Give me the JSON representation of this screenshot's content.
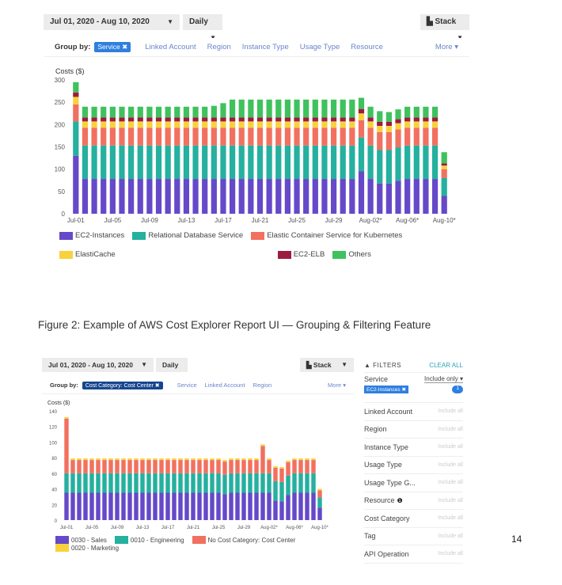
{
  "figure1": {
    "date_range": "Jul 01, 2020 - Aug 10, 2020",
    "granularity": "Daily",
    "chart_style": "Stack",
    "group_by_label": "Group by:",
    "group_by_chip": "Service",
    "group_links": [
      "Linked Account",
      "Region",
      "Instance Type",
      "Usage Type",
      "Resource"
    ],
    "more": "More"
  },
  "caption": "Figure 2: Example of AWS Cost Explorer Report UI — Grouping & Filtering Feature",
  "figure2": {
    "date_range": "Jul 01, 2020 - Aug 10, 2020",
    "granularity": "Daily",
    "chart_style": "Stack",
    "group_by_label": "Group by:",
    "group_by_chip": "Cost Category: Cost Center",
    "group_links": [
      "Service",
      "Linked Account",
      "Region"
    ],
    "more": "More",
    "filters": {
      "title": "FILTERS",
      "clear_all": "CLEAR ALL",
      "service": {
        "label": "Service",
        "mode": "Include only",
        "chip": "EC2-Instances",
        "count": "1"
      },
      "rows": [
        {
          "label": "Linked Account",
          "value": "Include all"
        },
        {
          "label": "Region",
          "value": "Include all"
        },
        {
          "label": "Instance Type",
          "value": "Include all"
        },
        {
          "label": "Usage Type",
          "value": "Include all"
        },
        {
          "label": "Usage Type G...",
          "value": "Include all"
        },
        {
          "label": "Resource",
          "value": "Include all"
        },
        {
          "label": "Cost Category",
          "value": "Include all"
        },
        {
          "label": "Tag",
          "value": "Include all"
        },
        {
          "label": "API Operation",
          "value": "Include all"
        }
      ]
    }
  },
  "page_number": "14",
  "chart_data": [
    {
      "type": "bar",
      "stacked": true,
      "ylabel": "Costs ($)",
      "ylim": [
        0,
        300
      ],
      "yticks": [
        0,
        50,
        100,
        150,
        200,
        250,
        300
      ],
      "xtick_labels": [
        "Jul-01",
        "Jul-05",
        "Jul-09",
        "Jul-13",
        "Jul-17",
        "Jul-21",
        "Jul-25",
        "Jul-29",
        "Aug-02*",
        "Aug-06*",
        "Aug-10*"
      ],
      "x": "daily Jul-01 .. Aug-10 (41 days)",
      "legend_position": "bottom",
      "series": [
        {
          "name": "EC2-Instances",
          "color": "#6549c9",
          "values": [
            130,
            78,
            78,
            78,
            78,
            78,
            78,
            78,
            78,
            78,
            78,
            78,
            78,
            78,
            78,
            78,
            78,
            78,
            78,
            78,
            78,
            78,
            78,
            78,
            78,
            78,
            78,
            78,
            78,
            78,
            78,
            95,
            78,
            68,
            68,
            74,
            78,
            78,
            78,
            78,
            40
          ]
        },
        {
          "name": "Relational Database Service",
          "color": "#25b09f",
          "values": [
            77,
            75,
            75,
            75,
            75,
            75,
            75,
            75,
            75,
            75,
            75,
            75,
            75,
            75,
            75,
            75,
            75,
            75,
            75,
            75,
            75,
            75,
            75,
            75,
            75,
            75,
            75,
            75,
            75,
            75,
            75,
            76,
            75,
            75,
            75,
            75,
            75,
            75,
            75,
            75,
            40
          ]
        },
        {
          "name": "Elastic Container Service for Kubernetes",
          "color": "#f2705f",
          "values": [
            38,
            40,
            40,
            40,
            40,
            40,
            40,
            40,
            40,
            40,
            40,
            40,
            40,
            40,
            40,
            40,
            40,
            40,
            40,
            40,
            40,
            40,
            40,
            40,
            40,
            40,
            40,
            40,
            40,
            40,
            40,
            39,
            40,
            40,
            40,
            40,
            40,
            40,
            40,
            40,
            20
          ]
        },
        {
          "name": "ElastiCache",
          "color": "#f8d23c",
          "values": [
            17,
            14,
            14,
            14,
            14,
            14,
            14,
            14,
            14,
            14,
            14,
            14,
            14,
            14,
            14,
            14,
            14,
            14,
            14,
            14,
            14,
            14,
            14,
            14,
            14,
            14,
            14,
            14,
            14,
            14,
            14,
            15,
            14,
            14,
            14,
            14,
            14,
            14,
            14,
            14,
            8
          ]
        },
        {
          "name": "EC2-ELB",
          "color": "#9c1c3f",
          "values": [
            10,
            9,
            9,
            9,
            9,
            9,
            9,
            9,
            9,
            9,
            9,
            9,
            9,
            9,
            9,
            9,
            9,
            9,
            9,
            9,
            9,
            9,
            9,
            9,
            9,
            9,
            9,
            9,
            9,
            9,
            9,
            10,
            9,
            9,
            9,
            9,
            9,
            9,
            9,
            9,
            5
          ]
        },
        {
          "name": "Others",
          "color": "#3fc25d",
          "values": [
            23,
            24,
            24,
            24,
            24,
            24,
            24,
            24,
            24,
            24,
            24,
            24,
            24,
            24,
            24,
            26,
            32,
            40,
            40,
            40,
            40,
            40,
            40,
            40,
            40,
            40,
            40,
            40,
            40,
            40,
            40,
            25,
            24,
            24,
            22,
            22,
            24,
            24,
            24,
            24,
            25
          ]
        }
      ]
    },
    {
      "type": "bar",
      "stacked": true,
      "ylabel": "Costs ($)",
      "ylim": [
        0,
        140
      ],
      "yticks": [
        0,
        20,
        40,
        60,
        80,
        100,
        120,
        140
      ],
      "xtick_labels": [
        "Jul-01",
        "Jul-05",
        "Jul-09",
        "Jul-13",
        "Jul-17",
        "Jul-21",
        "Jul-25",
        "Jul-29",
        "Aug-02*",
        "Aug-06*",
        "Aug-10*"
      ],
      "x": "daily Jul-01 .. Aug-10 (41 days)",
      "legend_position": "bottom",
      "series": [
        {
          "name": "0030 - Sales",
          "color": "#6549c9",
          "values": [
            35,
            35,
            35,
            35,
            35,
            35,
            35,
            35,
            35,
            35,
            35,
            35,
            35,
            35,
            35,
            35,
            35,
            35,
            35,
            35,
            35,
            35,
            35,
            35,
            35,
            33,
            35,
            35,
            35,
            35,
            35,
            35,
            35,
            25,
            24,
            32,
            35,
            35,
            35,
            35,
            16
          ]
        },
        {
          "name": "0010 - Engineering",
          "color": "#25b09f",
          "values": [
            25,
            25,
            25,
            25,
            25,
            25,
            25,
            25,
            25,
            25,
            25,
            25,
            25,
            25,
            25,
            25,
            25,
            25,
            25,
            25,
            25,
            25,
            25,
            25,
            25,
            25,
            25,
            25,
            25,
            25,
            25,
            25,
            25,
            25,
            25,
            25,
            25,
            25,
            25,
            25,
            13
          ]
        },
        {
          "name": "No Cost Category: Cost Center",
          "color": "#f2705f",
          "values": [
            70,
            17,
            17,
            17,
            17,
            17,
            17,
            17,
            17,
            17,
            17,
            17,
            17,
            17,
            17,
            17,
            17,
            17,
            17,
            17,
            17,
            17,
            17,
            17,
            17,
            17,
            17,
            17,
            17,
            17,
            17,
            35,
            17,
            17,
            17,
            17,
            17,
            17,
            17,
            17,
            9
          ]
        },
        {
          "name": "0020 - Marketing",
          "color": "#f8d23c",
          "values": [
            2,
            2,
            2,
            2,
            2,
            2,
            2,
            2,
            2,
            2,
            2,
            2,
            2,
            2,
            2,
            2,
            2,
            2,
            2,
            2,
            2,
            2,
            2,
            2,
            2,
            2,
            2,
            2,
            2,
            2,
            2,
            2,
            2,
            2,
            2,
            2,
            2,
            2,
            2,
            2,
            2
          ]
        }
      ]
    }
  ]
}
